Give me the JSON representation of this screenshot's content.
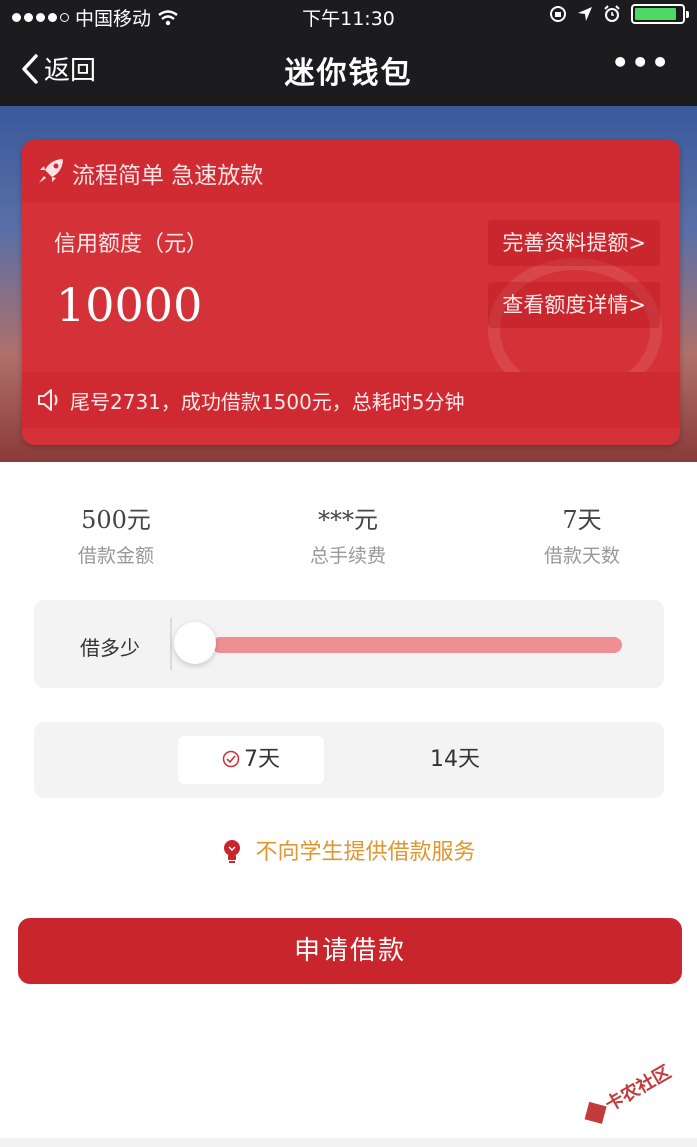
{
  "status_bar": {
    "carrier": "中国移动",
    "time": "下午11:30",
    "battery_level": 0.9
  },
  "nav": {
    "back_label": "返回",
    "title": "迷你钱包"
  },
  "card": {
    "header": "流程简单 急速放款",
    "credit_label": "信用额度（元）",
    "credit_amount": "10000",
    "link_improve": "完善资料提额>",
    "link_details": "查看额度详情>",
    "notice": "尾号2731，成功借款1500元，总耗时5分钟"
  },
  "stats": [
    {
      "value": "500元",
      "label": "借款金额"
    },
    {
      "value": "***元",
      "label": "总手续费"
    },
    {
      "value": "7天",
      "label": "借款天数"
    }
  ],
  "slider": {
    "label": "借多少",
    "value_fraction": 0.0
  },
  "days": {
    "options": [
      "7天",
      "14天"
    ],
    "selected": "7天"
  },
  "warning": "不向学生提供借款服务",
  "apply_button": "申请借款",
  "watermark": "卡农社区",
  "colors": {
    "primary_red": "#d43138",
    "button_red": "#c9252d",
    "warning_orange": "#e2962e",
    "slider_track": "#ef8f93"
  }
}
